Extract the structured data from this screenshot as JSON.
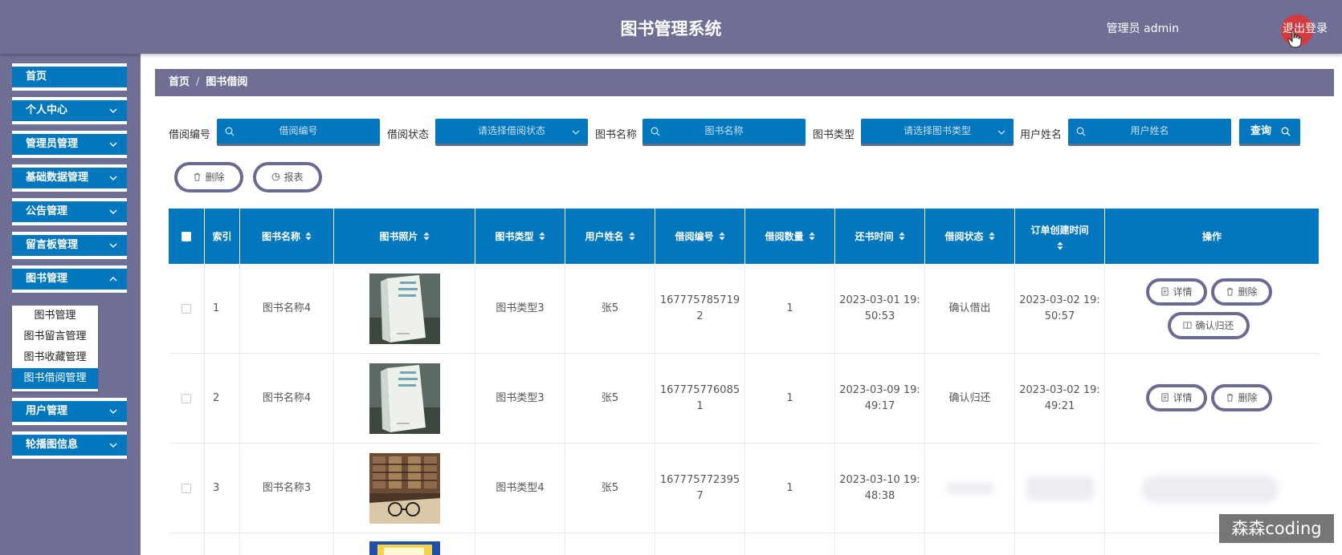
{
  "header": {
    "title": "图书管理系统",
    "admin_label": "管理员 admin",
    "logout_label": "退出登录"
  },
  "sidebar": {
    "items": [
      {
        "label": "首页"
      },
      {
        "label": "个人中心"
      },
      {
        "label": "管理员管理"
      },
      {
        "label": "基础数据管理"
      },
      {
        "label": "公告管理"
      },
      {
        "label": "留言板管理"
      },
      {
        "label": "图书管理"
      },
      {
        "label": "用户管理"
      },
      {
        "label": "轮播图信息"
      }
    ],
    "submenu": [
      {
        "label": "图书管理"
      },
      {
        "label": "图书留言管理"
      },
      {
        "label": "图书收藏管理"
      },
      {
        "label": "图书借阅管理",
        "active": true
      }
    ]
  },
  "breadcrumb": {
    "home": "首页",
    "separator": "/",
    "current": "图书借阅"
  },
  "filters": {
    "borrow_no_label": "借阅编号",
    "borrow_no_placeholder": "借阅编号",
    "status_label": "借阅状态",
    "status_placeholder": "请选择借阅状态",
    "book_name_label": "图书名称",
    "book_name_placeholder": "图书名称",
    "book_type_label": "图书类型",
    "book_type_placeholder": "请选择图书类型",
    "user_name_label": "用户姓名",
    "user_name_placeholder": "用户姓名",
    "query_label": "查询"
  },
  "toolbar": {
    "delete_label": "删除",
    "report_label": "报表"
  },
  "table": {
    "columns": [
      "索引",
      "图书名称",
      "图书照片",
      "图书类型",
      "用户姓名",
      "借阅编号",
      "借阅数量",
      "还书时间",
      "借阅状态",
      "订单创建时间",
      "操作"
    ],
    "rows": [
      {
        "index": "1",
        "book_name": "图书名称4",
        "book_type": "图书类型3",
        "user_name": "张5",
        "borrow_no_line1": "167775785719",
        "borrow_no_line2": "2",
        "quantity": "1",
        "return_time_line1": "2023-03-01 19:",
        "return_time_line2": "50:53",
        "status": "确认借出",
        "created_line1": "2023-03-02 19:",
        "created_line2": "50:57",
        "actions": [
          "详情",
          "删除",
          "确认归还"
        ]
      },
      {
        "index": "2",
        "book_name": "图书名称4",
        "book_type": "图书类型3",
        "user_name": "张5",
        "borrow_no_line1": "167775776085",
        "borrow_no_line2": "1",
        "quantity": "1",
        "return_time_line1": "2023-03-09 19:",
        "return_time_line2": "49:17",
        "status": "确认归还",
        "created_line1": "2023-03-02 19:",
        "created_line2": "49:21",
        "actions": [
          "详情",
          "删除"
        ]
      },
      {
        "index": "3",
        "book_name": "图书名称3",
        "book_type": "图书类型4",
        "user_name": "张5",
        "borrow_no_line1": "167775772395",
        "borrow_no_line2": "7",
        "quantity": "1",
        "return_time_line1": "2023-03-10 19:",
        "return_time_line2": "48:38"
      }
    ]
  },
  "watermark": "森森coding",
  "colors": {
    "header_bg": "#6f6f96",
    "accent_blue": "#0277bd",
    "pill_border": "#6a6a92",
    "cursor_red": "#e23434"
  }
}
